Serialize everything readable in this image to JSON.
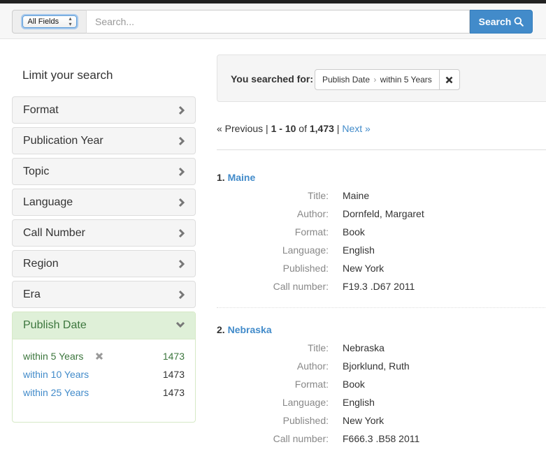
{
  "search": {
    "field_select": "All Fields",
    "placeholder": "Search...",
    "value": "",
    "button_label": "Search"
  },
  "sidebar": {
    "title": "Limit your search",
    "facets": [
      {
        "label": "Format"
      },
      {
        "label": "Publication Year"
      },
      {
        "label": "Topic"
      },
      {
        "label": "Language"
      },
      {
        "label": "Call Number"
      },
      {
        "label": "Region"
      },
      {
        "label": "Era"
      }
    ],
    "open_facet": {
      "label": "Publish Date",
      "values": [
        {
          "label": "within 5 Years",
          "count": "1473",
          "selected": true
        },
        {
          "label": "within 10 Years",
          "count": "1473",
          "selected": false
        },
        {
          "label": "within 25 Years",
          "count": "1473",
          "selected": false
        }
      ]
    }
  },
  "constraints": {
    "label": "You searched for:",
    "field": "Publish Date",
    "separator": "›",
    "value": "within 5 Years"
  },
  "pager": {
    "previous": "« Previous",
    "sep1": " | ",
    "start": "1",
    "dash": " - ",
    "end": "10",
    "of": " of ",
    "total": "1,473",
    "sep2": " | ",
    "next": "Next »"
  },
  "documents": [
    {
      "number": "1.",
      "title_link": "Maine",
      "fields": [
        {
          "key": "Title:",
          "value": "Maine"
        },
        {
          "key": "Author:",
          "value": "Dornfeld, Margaret"
        },
        {
          "key": "Format:",
          "value": "Book"
        },
        {
          "key": "Language:",
          "value": "English"
        },
        {
          "key": "Published:",
          "value": "New York"
        },
        {
          "key": "Call number:",
          "value": "F19.3 .D67 2011"
        }
      ]
    },
    {
      "number": "2.",
      "title_link": "Nebraska",
      "fields": [
        {
          "key": "Title:",
          "value": "Nebraska"
        },
        {
          "key": "Author:",
          "value": "Bjorklund, Ruth"
        },
        {
          "key": "Format:",
          "value": "Book"
        },
        {
          "key": "Language:",
          "value": "English"
        },
        {
          "key": "Published:",
          "value": "New York"
        },
        {
          "key": "Call number:",
          "value": "F666.3 .B58 2011"
        }
      ]
    }
  ],
  "colors": {
    "link": "#428bca",
    "primary_button": "#428bca",
    "facet_active_bg": "#dff0d8",
    "facet_active_text": "#3c763d"
  }
}
